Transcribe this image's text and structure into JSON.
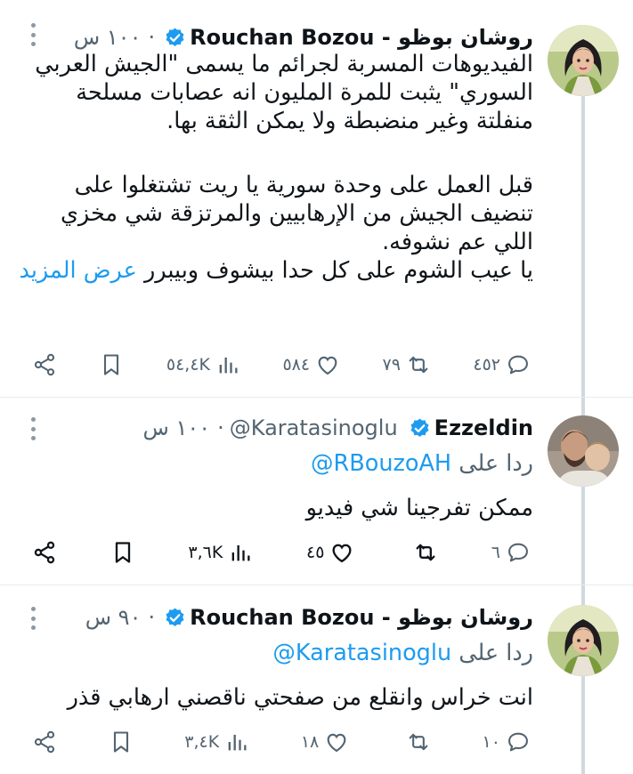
{
  "tweets": [
    {
      "name": "روشان بوظو - Rouchan Bozou",
      "handle": "",
      "time": "١٠٠ س",
      "body_lines": [
        "الفيديوهات المسربة لجرائم ما يسمى \"الجيش العربي",
        "السوري\" يثبت للمرة المليون انه عصابات مسلحة",
        "منفلتة وغير منضبطة ولا يمكن الثقة بها.",
        "",
        "قبل العمل على وحدة سورية يا ريت تشتغلوا على",
        "تنضيف الجيش من الإرهابيين والمرتزقة شي مخزي",
        "اللي عم نشوفه."
      ],
      "last_line_text": "يا عيب الشوم على كل حدا بيشوف وبيبرر",
      "show_more": "عرض المزيد",
      "replies": "٤٥٢",
      "retweets": "٧٩",
      "likes": "٥٨٤",
      "views": "٥٤,٤K",
      "avatar": "woman-cartoon-avatar"
    },
    {
      "name": "Ezzeldin",
      "handle": "@Karatasinoglu",
      "time": "١٠٠ س",
      "reply_prefix": "ردا على",
      "reply_to": "@RBouzoAH",
      "body": "ممكن تفرجينا شي فيديو",
      "replies": "٦",
      "retweets": "",
      "likes": "٤٥",
      "views": "٣,٦K",
      "avatar": "man-with-child-photo"
    },
    {
      "name": "روشان بوظو - Rouchan Bozou",
      "handle": "",
      "time": "٩٠ س",
      "reply_prefix": "ردا على",
      "reply_to": "@Karatasinoglu",
      "body": "انت خراس وانقلع من صفحتي ناقصني ارهابي قذر",
      "replies": "١٠",
      "retweets": "",
      "likes": "١٨",
      "views": "٣,٤K",
      "avatar": "woman-cartoon-avatar"
    }
  ],
  "colors": {
    "accent": "#1d9bf0",
    "muted": "#536471",
    "thread_line": "#cfd9de",
    "text": "#0f1419"
  },
  "icons": [
    "more-dots-icon",
    "verified-badge-icon",
    "reply-icon",
    "retweet-icon",
    "like-icon",
    "views-icon",
    "bookmark-icon",
    "share-icon"
  ]
}
